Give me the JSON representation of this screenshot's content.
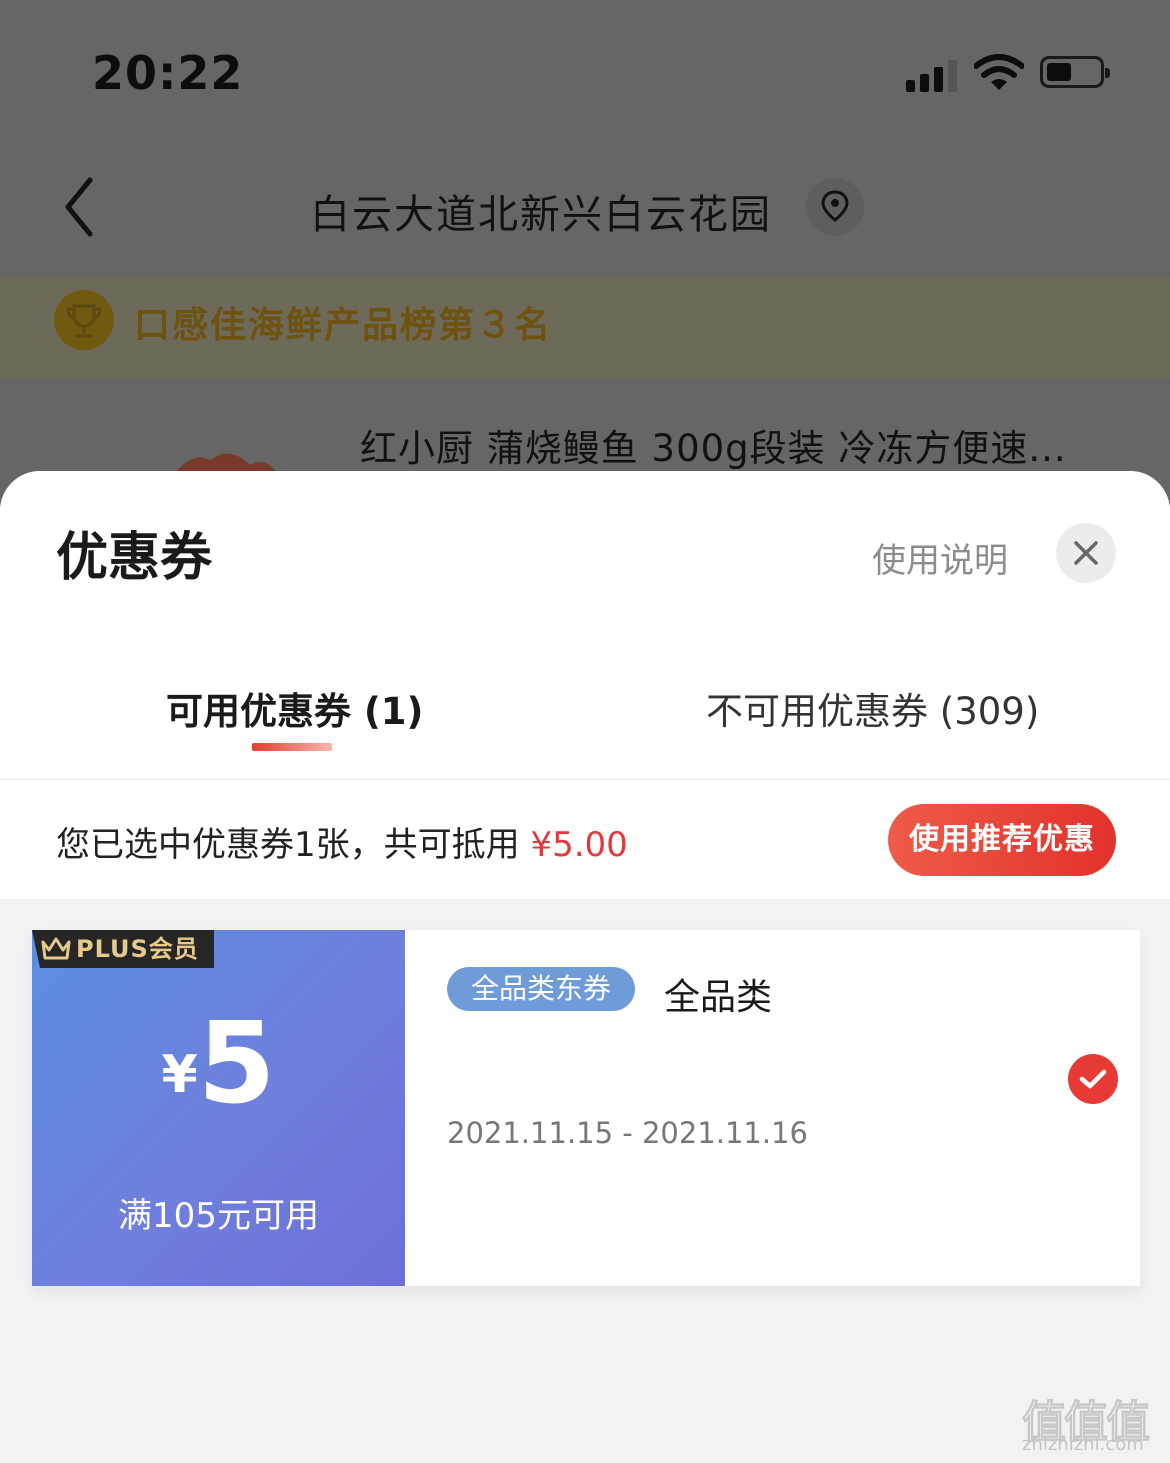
{
  "status_bar": {
    "time": "20:22"
  },
  "header": {
    "address": "白云大道北新兴白云花园"
  },
  "rank_banner": {
    "text": "口感佳海鲜产品榜第３名"
  },
  "product": {
    "title": "红小厨 蒲烧鳗鱼 300g段装 冷冻方便速..."
  },
  "sheet": {
    "title": "优惠券",
    "help_link": "使用说明",
    "tabs": [
      {
        "label": "可用优惠券 (1)",
        "active": true
      },
      {
        "label": "不可用优惠券 (309)",
        "active": false
      }
    ],
    "summary_prefix": "您已选中优惠券1张，共可抵用 ",
    "summary_amount": "¥5.00",
    "recommend_button": "使用推荐优惠"
  },
  "coupons": [
    {
      "badge": "PLUS会员",
      "currency": "¥",
      "amount": "5",
      "threshold": "满105元可用",
      "category_badge": "全品类东券",
      "category": "全品类",
      "valid_dates": "2021.11.15 - 2021.11.16",
      "selected": true
    }
  ],
  "watermark": {
    "logo": "值值值",
    "url": "zhizhizhi.com"
  },
  "colors": {
    "accent_red": "#e4393c",
    "coupon_gradient_start": "#5b8ee0",
    "coupon_gradient_end": "#6d6fd8",
    "category_badge": "#6f9bd9"
  }
}
